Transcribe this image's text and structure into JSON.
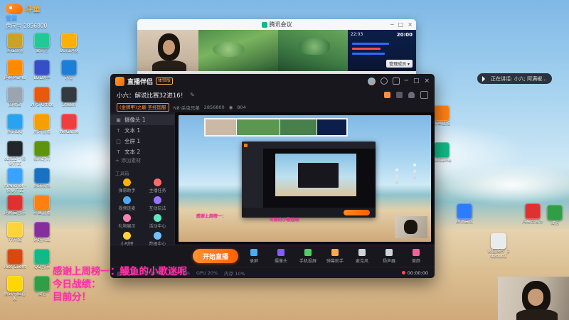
{
  "watermark": {
    "logo_text": "斗鱼",
    "subtitle": "雪屋",
    "room_label": "房间号",
    "room_number": "2856800"
  },
  "toast": {
    "text": "正在讲话: 小六; 阿满椒..."
  },
  "desktop": {
    "left_icons": [
      {
        "label": "英雄联盟",
        "color": "#c9a227"
      },
      {
        "label": "网易MuMu",
        "color": "#ff8a00"
      },
      {
        "label": "回收站",
        "color": "#9aa5b1"
      },
      {
        "label": "腾讯QQ",
        "color": "#29a3f1"
      },
      {
        "label": "obs32 - 快捷方式",
        "color": "#22262b"
      },
      {
        "label": "YYAnchor - 快捷方式",
        "color": "#3aa3ff"
      },
      {
        "label": "网易云音乐",
        "color": "#e03131"
      },
      {
        "label": "YY升级",
        "color": "#ffd43b"
      },
      {
        "label": "Riot Client",
        "color": "#d9480f"
      },
      {
        "label": "腾讯电脑管家",
        "color": "#ffd700"
      },
      {
        "label": "爱奇艺",
        "color": "#20c997"
      },
      {
        "label": "LOL助手",
        "color": "#364fc7"
      },
      {
        "label": "WPS Office",
        "color": "#e8590c"
      },
      {
        "label": "虎牙直播",
        "color": "#f59f00"
      },
      {
        "label": "疾风之刃",
        "color": "#5c940d"
      },
      {
        "label": "腾讯视频",
        "color": "#1971c2"
      },
      {
        "label": "斗鱼直播",
        "color": "#ff7f11"
      },
      {
        "label": "穿越火线",
        "color": "#862e9c"
      },
      {
        "label": "QQ音乐",
        "color": "#12b886"
      },
      {
        "label": "微信",
        "color": "#2f9e44"
      },
      {
        "label": "UU加速器",
        "color": "#fab005"
      },
      {
        "label": "迅雷",
        "color": "#1c7ed6"
      },
      {
        "label": "Steam",
        "color": "#343a40"
      },
      {
        "label": "WeGame",
        "color": "#f03e3e"
      }
    ],
    "right_icons": [
      {
        "label": "斗鱼直播",
        "color": "#ff7f11"
      },
      {
        "label": "WeGame",
        "color": "#12b886"
      },
      {
        "label": "腾讯会议",
        "color": "#2b7cff"
      },
      {
        "label": "网易云音乐",
        "color": "#e03131"
      },
      {
        "label": "微信",
        "color": "#2f9e44"
      },
      {
        "label": "微信图片_2020101",
        "color": "#e9ecef"
      }
    ]
  },
  "meeting": {
    "title": "腾讯会议",
    "time": "20:00",
    "score_time": "22:03",
    "members_button": "管理成员 ▾",
    "controls": {
      "min": "─",
      "max": "□",
      "close": "×"
    }
  },
  "studio": {
    "app_name": "直播伴侣",
    "badge": "体验版",
    "stream_title": "小六：解说比赛32进16！",
    "edit_glyph": "✎",
    "category_tag": "(金牌甲)之巅·圣经国服",
    "team_text": "N8·杀虫兄弟",
    "room_id": "2856800",
    "viewers_glyph": "◉",
    "viewers": "804",
    "controls": {
      "min": "─",
      "max": "□",
      "close": "×"
    },
    "sidebar": {
      "scenes": [
        {
          "glyph": "▣",
          "label": "摄像头 1"
        },
        {
          "glyph": "T",
          "label": "文本 1"
        },
        {
          "glyph": "□",
          "label": "全屏 1"
        },
        {
          "glyph": "T",
          "label": "文本 2"
        }
      ],
      "add_label": "+ 添加素材",
      "tools_title": "工具箱",
      "tools": [
        {
          "label": "弹幕助手",
          "color": "#ffb300"
        },
        {
          "label": "主播任务",
          "color": "#ff6b6b"
        },
        {
          "label": "视频连麦",
          "color": "#4dabf7"
        },
        {
          "label": "互动玩法",
          "color": "#9775fa"
        },
        {
          "label": "礼物展示",
          "color": "#f783ac"
        },
        {
          "label": "活动中心",
          "color": "#63e6be"
        },
        {
          "label": "小时榜",
          "color": "#ffd43b"
        },
        {
          "label": "数据中心",
          "color": "#74c0fc"
        }
      ]
    },
    "toolbar": {
      "items": [
        {
          "label": "录屏",
          "color": "#4dabf7"
        },
        {
          "label": "摄像头",
          "color": "#845ef7"
        },
        {
          "label": "手机投屏",
          "color": "#51cf66"
        },
        {
          "label": "弹幕助手",
          "color": "#ffa94d"
        },
        {
          "label": "麦克风",
          "color": "#ced4da"
        },
        {
          "label": "扬声器",
          "color": "#ced4da"
        },
        {
          "label": "美颜",
          "color": "#f06595"
        }
      ],
      "start_button": "开始直播"
    },
    "statusbar": {
      "duration_label": "直播时长",
      "duration": "00:00:00",
      "cpu": "CPU 20%",
      "gpu": "GPU 20%",
      "mem": "内存 10%",
      "rec_time": "00:00:00"
    }
  },
  "overlay": {
    "pink_lines": [
      "感谢上周榜一：鳗鱼的小歌迷呢",
      "今日战绩：",
      "目前分！"
    ],
    "mini_pink_a": "感谢上周榜一：",
    "mini_pink_b": "斗鱼的小歌迷呢",
    "pink_color": "#ff2fa8"
  }
}
